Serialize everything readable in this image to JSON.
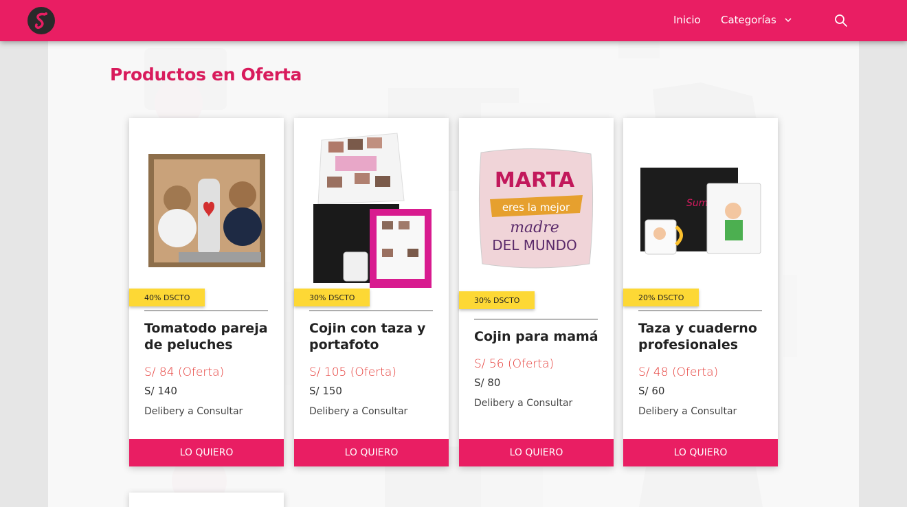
{
  "nav": {
    "logo_icon": "s-logo-icon",
    "links": [
      {
        "label": "Inicio"
      },
      {
        "label": "Categorías",
        "icon": "chevron-down-icon"
      }
    ],
    "search_icon": "search-icon",
    "color": "#e91e63"
  },
  "section": {
    "title": "Productos en Oferta",
    "title_color": "#d81b5c"
  },
  "products": [
    {
      "badge": "40% DSCTO",
      "title": "Tomatodo pareja de peluches",
      "price_offer": "S/ 84 (Oferta)",
      "price_old": "S/ 140",
      "delivery": "Delibery a Consultar",
      "button": "LO QUIERO",
      "image": "teddy-bears-bottle-box"
    },
    {
      "badge": "30% DSCTO",
      "title": "Cojin con taza y portafoto",
      "price_offer": "S/ 105 (Oferta)",
      "price_old": "S/ 150",
      "delivery": "Delibery a Consultar",
      "button": "LO QUIERO",
      "image": "photo-pillow-mug-frame"
    },
    {
      "badge": "30% DSCTO",
      "title": "Cojin para mamá",
      "price_offer": "S/ 56 (Oferta)",
      "price_old": "S/ 80",
      "delivery": "Delibery a Consultar",
      "button": "LO QUIERO",
      "image": "marta-pillow",
      "pillow_text": [
        "MARTA",
        "eres la mejor",
        "madre",
        "DEL MUNDO"
      ]
    },
    {
      "badge": "20% DSCTO",
      "title": "Taza y cuaderno profesionales",
      "price_offer": "S/ 48 (Oferta)",
      "price_old": "S/ 60",
      "delivery": "Delibery a Consultar",
      "button": "LO QUIERO",
      "image": "mug-notebook-box"
    }
  ],
  "colors": {
    "accent": "#e91e63",
    "badge": "#fdd835",
    "offer_price": "#e53935"
  }
}
